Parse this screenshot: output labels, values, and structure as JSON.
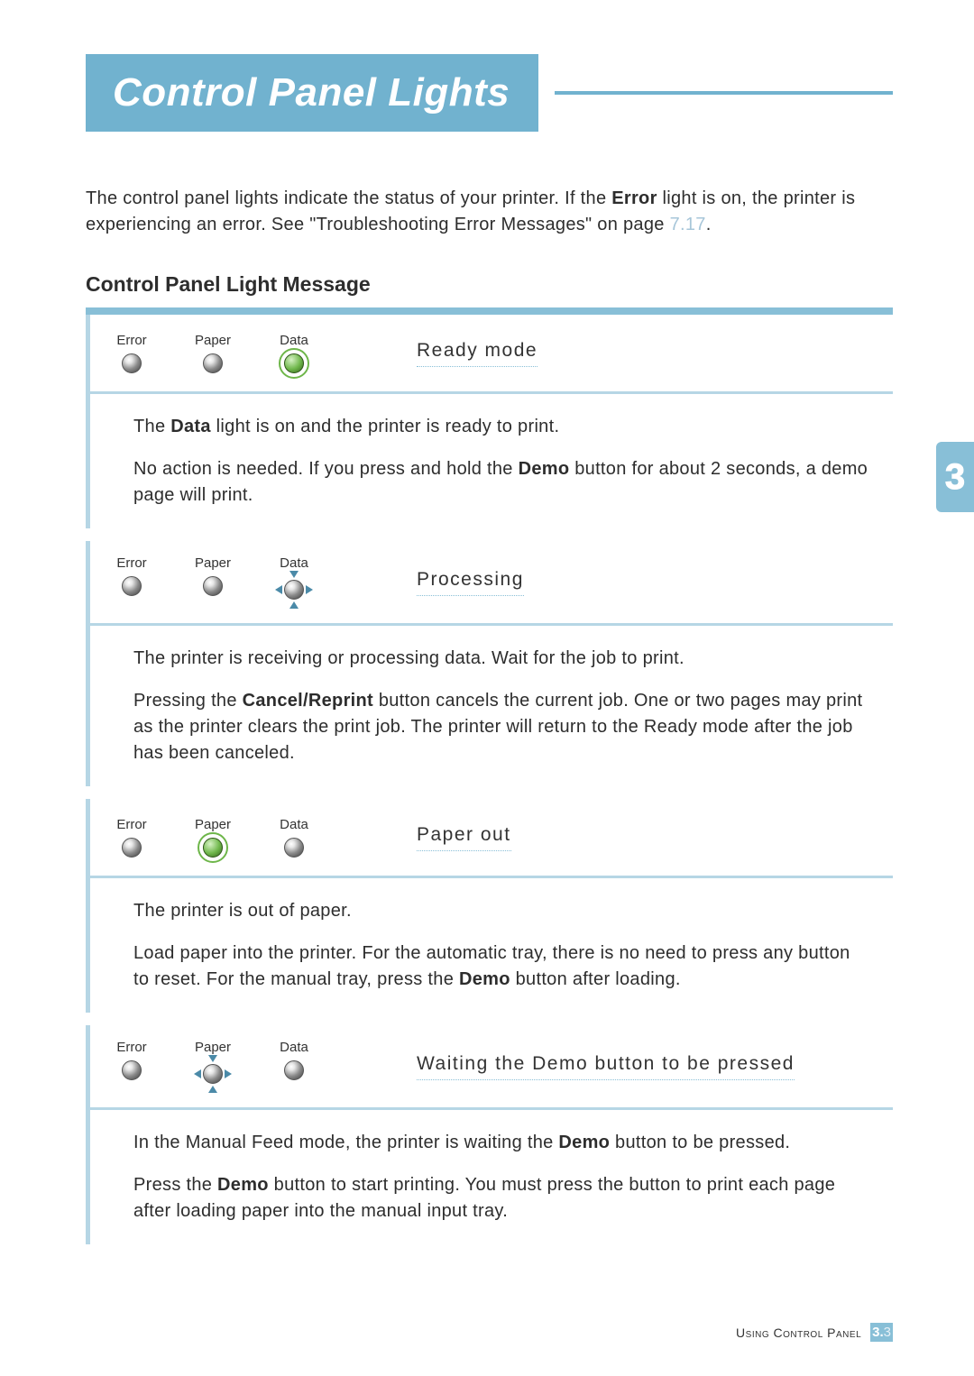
{
  "title": "Control Panel Lights",
  "intro_pre": "The control panel lights indicate the status of your printer. If the ",
  "intro_error": "Error",
  "intro_mid": " light is on, the printer is experiencing an error. See \"Troubleshooting Error Messages\" on page ",
  "intro_link": "7.17",
  "intro_end": ".",
  "subtitle": "Control Panel Light Message",
  "light_labels": {
    "error": "Error",
    "paper": "Paper",
    "data": "Data"
  },
  "blocks": [
    {
      "mode": "Ready mode",
      "lights": {
        "error": "off",
        "paper": "off",
        "data": "on"
      },
      "body": [
        {
          "pre": "The ",
          "bold": "Data",
          "post": " light is on and the printer is ready to print."
        },
        {
          "pre": "No action is needed. If you press and hold the ",
          "bold": "Demo",
          "post": " button for about 2 seconds, a demo page will print."
        }
      ]
    },
    {
      "mode": "Processing",
      "lights": {
        "error": "off",
        "paper": "off",
        "data": "blink"
      },
      "body": [
        {
          "pre": "The printer is receiving or processing data. Wait for the job to print.",
          "bold": "",
          "post": ""
        },
        {
          "pre": "Pressing the ",
          "bold": "Cancel/Reprint",
          "post": " button cancels the current job. One or two pages may print as the printer clears the print job. The printer will return to the Ready mode after the job has been canceled."
        }
      ]
    },
    {
      "mode": "Paper out",
      "lights": {
        "error": "off",
        "paper": "on",
        "data": "off"
      },
      "body": [
        {
          "pre": "The printer is out of paper.",
          "bold": "",
          "post": ""
        },
        {
          "pre": "Load paper into the printer. For the automatic tray, there is no need to press any button to reset. For the manual tray, press the ",
          "bold": "Demo",
          "post": " button after loading."
        }
      ]
    },
    {
      "mode": "Waiting the Demo button to be pressed",
      "lights": {
        "error": "off",
        "paper": "blink",
        "data": "off"
      },
      "body": [
        {
          "pre": "In the Manual Feed mode, the printer is waiting the ",
          "bold": "Demo",
          "post": " button to be pressed."
        },
        {
          "pre": "Press the ",
          "bold": "Demo",
          "post": " button to start printing. You must press the button to print each page after loading paper into the manual input tray."
        }
      ]
    }
  ],
  "side_tab": "3",
  "footer_text": "Using Control Panel",
  "footer_page_major": "3.",
  "footer_page_minor": "3"
}
